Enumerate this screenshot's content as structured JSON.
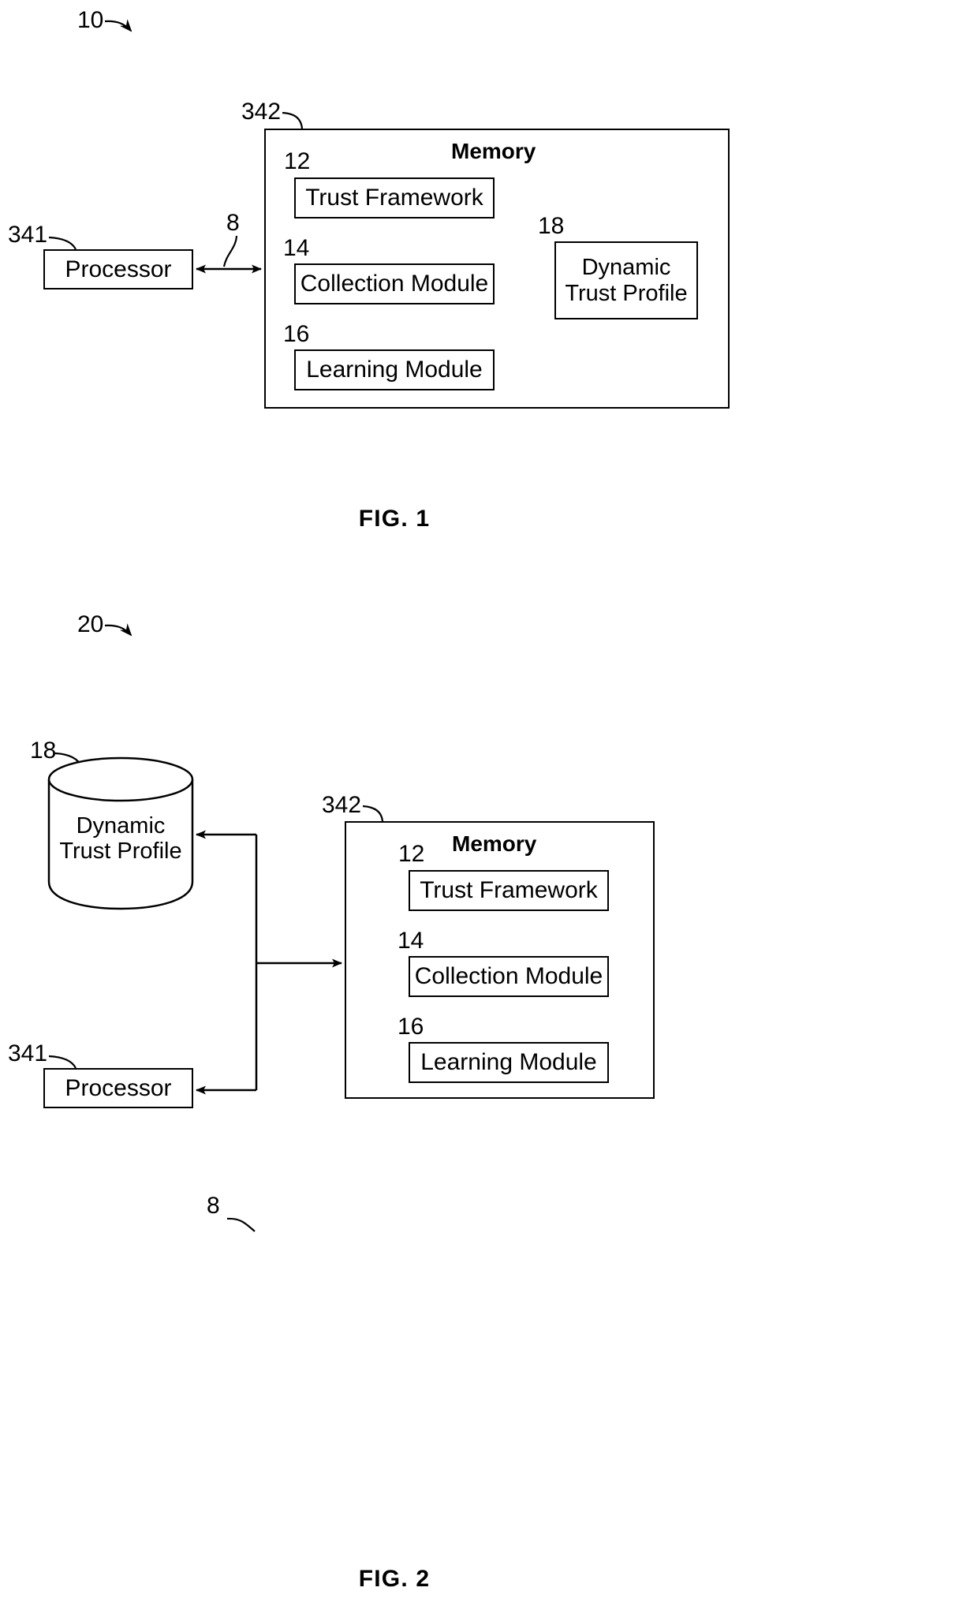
{
  "figure1": {
    "ref_system": "10",
    "ref_memory": "342",
    "ref_processor": "341",
    "ref_bus": "8",
    "ref_trust_framework": "12",
    "ref_collection_module": "14",
    "ref_learning_module": "16",
    "ref_dynamic_trust_profile": "18",
    "memory_title": "Memory",
    "processor_label": "Processor",
    "trust_framework_label": "Trust Framework",
    "collection_module_label": "Collection Module",
    "learning_module_label": "Learning Module",
    "dynamic_trust_profile_label": "Dynamic\nTrust Profile",
    "caption": "FIG. 1"
  },
  "figure2": {
    "ref_system": "20",
    "ref_memory": "342",
    "ref_processor": "341",
    "ref_bus": "8",
    "ref_trust_framework": "12",
    "ref_collection_module": "14",
    "ref_learning_module": "16",
    "ref_dynamic_trust_profile": "18",
    "memory_title": "Memory",
    "processor_label": "Processor",
    "trust_framework_label": "Trust Framework",
    "collection_module_label": "Collection Module",
    "learning_module_label": "Learning Module",
    "dynamic_trust_profile_label": "Dynamic\nTrust Profile",
    "caption": "FIG. 2"
  },
  "style": {
    "line_color": "#000000",
    "background": "#ffffff"
  }
}
